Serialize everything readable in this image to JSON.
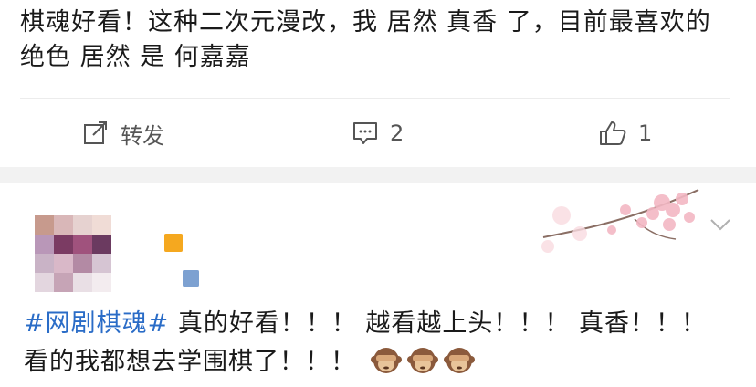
{
  "post": {
    "text": "棋魂好看！这种二次元漫改，我 居然 真香 了，目前最喜欢的绝色 居然 是 何嘉嘉"
  },
  "actions": {
    "repost_label": "转发",
    "comment_count": "2",
    "like_count": "1"
  },
  "comment": {
    "hashtag": "#网剧棋魂#",
    "text": " 真的好看！！！ 越看越上头！！！ 真香！！！ 看的我都想去学围棋了！！！",
    "emoji_count": 3
  },
  "colors": {
    "hashtag": "#2a6cc7",
    "action_gray": "#555555",
    "separator": "#f2f2f2"
  },
  "icons": [
    "repost-icon",
    "comment-icon",
    "like-icon",
    "chevron-down-icon",
    "see-no-evil-monkey-icon"
  ]
}
